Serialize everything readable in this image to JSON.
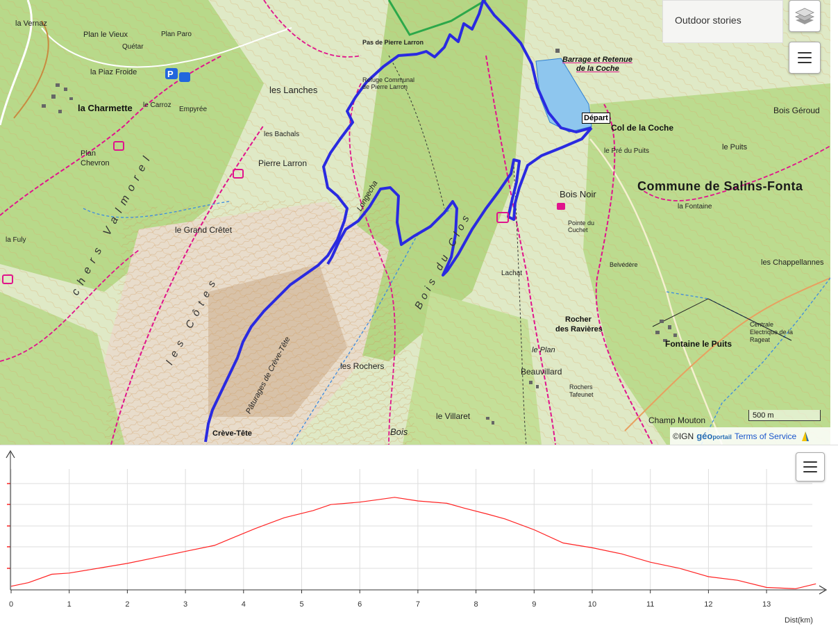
{
  "map": {
    "depart_label": "Départ",
    "outdoor_stories": "Outdoor stories",
    "scale": "500 m",
    "attribution": {
      "ign": "©IGN",
      "geo": "géo",
      "portail": "portail",
      "terms": "Terms of Service"
    },
    "labels": {
      "commune": "Commune de Salins-Fonta",
      "valmorel": "chers  Valmorel",
      "les_cotes": "les  Côtes",
      "bois_du_clos": "Bois  du  Clos",
      "pas_larron": "Pas de Pierre Larron",
      "refuge": "Refuge Communal de Pierre Larron",
      "barrage1": "Barrage et Retenue",
      "barrage2": "de la Coche",
      "col": "Col de la Coche",
      "la_charmette": "la Charmette",
      "les_lanches": "les Lanches",
      "pierre_larron": "Pierre Larron",
      "le_grand_cretet": "le Grand Crêtet",
      "bois_noir": "Bois Noir",
      "bois_geroud": "Bois Géroud",
      "fontaine": "Fontaine le Puits",
      "rocher": "Rocher",
      "des_ravieres": "des Ravières",
      "creve_tete": "Crève-Tête",
      "les_rochers": "les Rochers",
      "beauvillard": "Beauvillard",
      "le_villaret": "le Villaret",
      "champ_mouton": "Champ Mouton",
      "chappellannes": "les Chappellannes",
      "plan_chevron": "Plan Chevron",
      "la_piaz_froide": "la Piaz Froide",
      "empyree": "Empyrée",
      "le_puits": "le Puits",
      "lachat": "Lachat",
      "le_plan": "le Plan",
      "les_bachals": "les Bachals",
      "la_fuly": "la Fuly",
      "plan_le_vieux": "Plan le Vieux",
      "la_vernaz": "la Vernaz",
      "longecha": "Longecha",
      "paturages": "Pâturages de Crève-Tête",
      "centrale": "Centrale Electrique de la Rageat",
      "la_fontaine": "la Fontaine",
      "pointe_cuchet": "Pointe du Cuchet",
      "belvedere": "Belvédère",
      "le_pre_du_puits": "le Pré du Puits",
      "bois": "Bois",
      "rochers_tafeunet": "Rochers Tafeunet",
      "plan_paro": "Plan Paro",
      "quetar": "Quétar",
      "le_carroz": "le Carroz"
    },
    "colors": {
      "track": "#2222ee",
      "trail": "#e0148c",
      "water": "#8ec6ee"
    },
    "icons": [
      "layers-icon",
      "menu-icon",
      "parking-icon",
      "refuge-icon"
    ]
  },
  "profile": {
    "x_axis_label": "Dist(km)",
    "colors": {
      "line": "#ff2222",
      "grid": "#dddddd"
    }
  },
  "chart_data": {
    "type": "line",
    "title": "",
    "xlabel": "Dist(km)",
    "ylabel": "",
    "x_ticks": [
      0,
      1,
      2,
      3,
      4,
      5,
      6,
      7,
      8,
      9,
      10,
      11,
      12,
      13
    ],
    "xlim": [
      0,
      14
    ],
    "grid": true,
    "series": [
      {
        "x": [
          0,
          0.3,
          0.7,
          1.0,
          1.5,
          2.0,
          2.5,
          3.0,
          3.5,
          3.8,
          4.2,
          4.7,
          5.2,
          5.5,
          6.0,
          6.3,
          6.6,
          7.0,
          7.5,
          7.8,
          8.2,
          8.5,
          9.0,
          9.5,
          10.0,
          10.5,
          11.0,
          11.5,
          12.0,
          12.5,
          13.0,
          13.5,
          13.85
        ],
        "y": [
          0.03,
          0.06,
          0.13,
          0.14,
          0.18,
          0.22,
          0.27,
          0.32,
          0.37,
          0.43,
          0.51,
          0.6,
          0.66,
          0.71,
          0.73,
          0.75,
          0.77,
          0.74,
          0.72,
          0.68,
          0.63,
          0.59,
          0.5,
          0.39,
          0.35,
          0.3,
          0.23,
          0.18,
          0.11,
          0.08,
          0.02,
          0.01,
          0.05
        ]
      }
    ]
  }
}
